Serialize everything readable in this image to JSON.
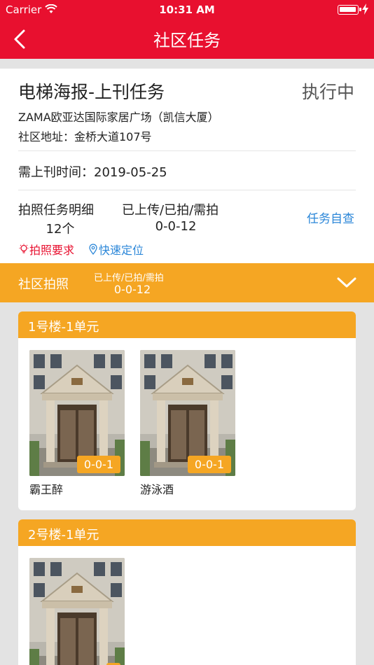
{
  "status_bar": {
    "carrier": "Carrier",
    "time": "10:31 AM"
  },
  "nav": {
    "title": "社区任务",
    "back_icon": "chevron-left-icon"
  },
  "task": {
    "title": "电梯海报-上刊任务",
    "status": "执行中",
    "venue": "ZAMA欧亚达国际家居广场（凯信大厦）",
    "address": "社区地址：金桥大道107号",
    "date": "需上刊时间：2019-05-25",
    "detail_label": "拍照任务明细",
    "detail_count": "12个",
    "progress_label": "已上传/已拍/需拍",
    "progress_value": "0-0-12",
    "self_check": "任务自查",
    "photo_requirements": "拍照要求",
    "quick_locate": "快速定位"
  },
  "section": {
    "title": "社区拍照",
    "progress_label": "已上传/已拍/需拍",
    "progress_value": "0-0-12"
  },
  "buildings": [
    {
      "name": "1号楼-1单元",
      "tiles": [
        {
          "badge": "0-0-1",
          "label": "霸王醉"
        },
        {
          "badge": "0-0-1",
          "label": "游泳酒"
        }
      ]
    },
    {
      "name": "2号楼-1单元",
      "tiles": [
        {
          "badge": "",
          "label": ""
        }
      ]
    }
  ],
  "colors": {
    "brand_red": "#e8102f",
    "accent_orange": "#f5a623",
    "link_blue": "#2a86d8"
  }
}
